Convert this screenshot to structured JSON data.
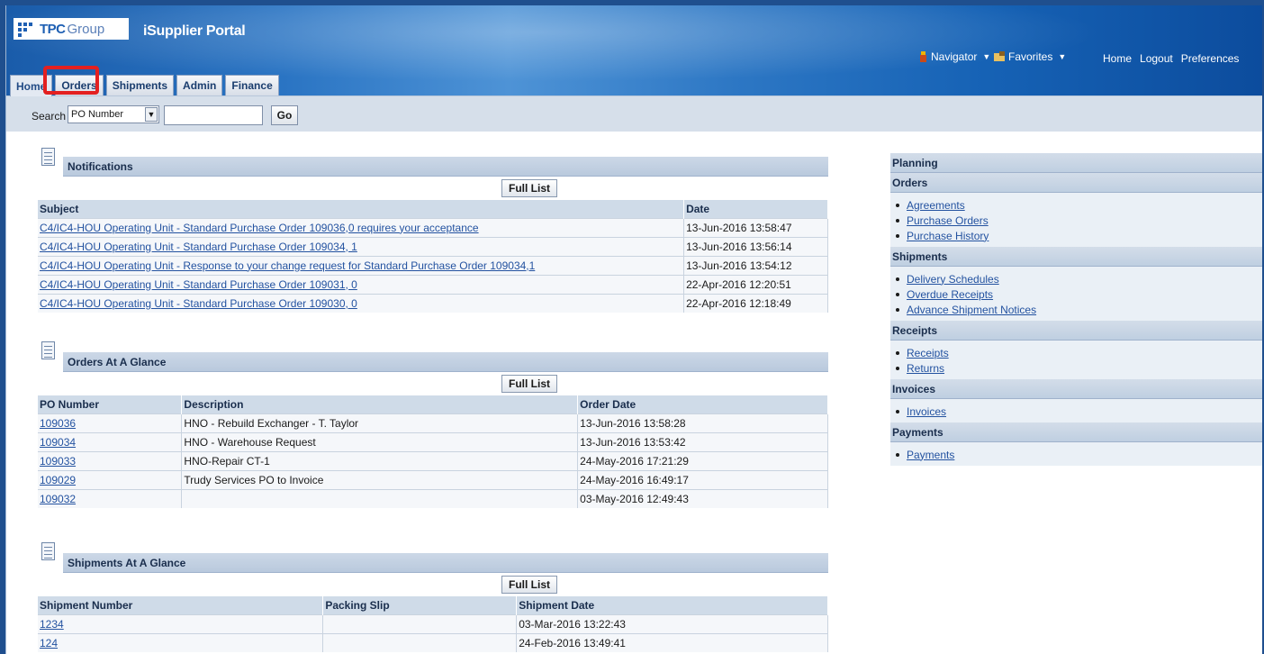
{
  "header": {
    "logo_text": "TPC",
    "logo_text2": "Group",
    "app_title": "iSupplier Portal",
    "navigator_label": "Navigator",
    "favorites_label": "Favorites",
    "home_link": "Home",
    "logout_link": "Logout",
    "preferences_link": "Preferences"
  },
  "tabs": [
    {
      "label": "Home",
      "active": true
    },
    {
      "label": "Orders",
      "active": false
    },
    {
      "label": "Shipments",
      "active": false
    },
    {
      "label": "Admin",
      "active": false
    },
    {
      "label": "Finance",
      "active": false
    }
  ],
  "search": {
    "label": "Search",
    "selected_option": "PO Number",
    "input_value": "",
    "go_label": "Go"
  },
  "notifications": {
    "title": "Notifications",
    "full_list_label": "Full List",
    "columns": [
      "Subject",
      "Date"
    ],
    "rows": [
      [
        "C4/IC4-HOU Operating Unit - Standard Purchase Order 109036,0 requires your acceptance",
        "13-Jun-2016 13:58:47"
      ],
      [
        "C4/IC4-HOU Operating Unit - Standard Purchase Order 109034, 1",
        "13-Jun-2016 13:56:14"
      ],
      [
        "C4/IC4-HOU Operating Unit - Response to your change request for Standard Purchase Order 109034,1",
        "13-Jun-2016 13:54:12"
      ],
      [
        "C4/IC4-HOU Operating Unit - Standard Purchase Order 109031, 0",
        "22-Apr-2016 12:20:51"
      ],
      [
        "C4/IC4-HOU Operating Unit - Standard Purchase Order 109030, 0",
        "22-Apr-2016 12:18:49"
      ]
    ]
  },
  "orders": {
    "title": "Orders At A Glance",
    "full_list_label": "Full List",
    "columns": [
      "PO Number",
      "Description",
      "Order Date"
    ],
    "rows": [
      [
        "109036",
        "HNO - Rebuild Exchanger - T. Taylor",
        "13-Jun-2016 13:58:28"
      ],
      [
        "109034",
        "HNO - Warehouse Request",
        "13-Jun-2016 13:53:42"
      ],
      [
        "109033",
        "HNO-Repair CT-1",
        "24-May-2016 17:21:29"
      ],
      [
        "109029",
        "Trudy Services PO to Invoice",
        "24-May-2016 16:49:17"
      ],
      [
        "109032",
        "",
        "03-May-2016 12:49:43"
      ]
    ]
  },
  "shipments": {
    "title": "Shipments At A Glance",
    "full_list_label": "Full List",
    "columns": [
      "Shipment Number",
      "Packing Slip",
      "Shipment Date"
    ],
    "rows": [
      [
        "1234",
        "",
        "03-Mar-2016 13:22:43"
      ],
      [
        "124",
        "",
        "24-Feb-2016 13:49:41"
      ]
    ]
  },
  "rightnav": {
    "planning": "Planning",
    "sections": [
      {
        "title": "Orders",
        "items": [
          "Agreements",
          "Purchase Orders",
          "Purchase History"
        ]
      },
      {
        "title": "Shipments",
        "items": [
          "Delivery Schedules",
          "Overdue Receipts",
          "Advance Shipment Notices"
        ]
      },
      {
        "title": "Receipts",
        "items": [
          "Receipts",
          "Returns"
        ]
      },
      {
        "title": "Invoices",
        "items": [
          "Invoices"
        ]
      },
      {
        "title": "Payments",
        "items": [
          "Payments"
        ]
      }
    ]
  }
}
